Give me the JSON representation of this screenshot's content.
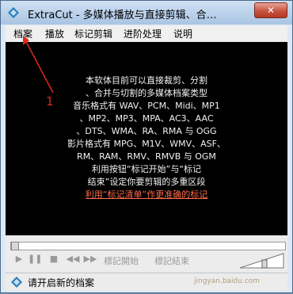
{
  "window": {
    "title": "ExtraCut - 多媒体播放与直接剪辑、合…"
  },
  "menu": [
    {
      "label": "档案"
    },
    {
      "label": "播放"
    },
    {
      "label": "标记剪辑"
    },
    {
      "label": "进阶处理"
    },
    {
      "label": "说明"
    }
  ],
  "content": {
    "lines": [
      "本软体目前可以直接裁剪、分割",
      "、合并与切割的多媒体档案类型",
      "音乐格式有 WAV、PCM、Midi、MP1",
      "、MP2、MP3、MPA、AC3、AAC",
      "、DTS、WMA、RA、RMA 与 OGG",
      "影片格式有 MPG、M1V、WMV、ASF、",
      "RM、RAM、RMV、RMVB 与 OGM",
      "利用按钮“标记开始”与“标记",
      "结束”设定你要剪辑的多重区段",
      "利用“标记清单”作更准确的标记"
    ]
  },
  "annotation": {
    "number": "1"
  },
  "controls": {
    "mark_start_label": "標記開始",
    "mark_end_label": "標記結束",
    "progress": 0
  },
  "status": {
    "text": "请开启新的档案"
  },
  "watermark": {
    "text": "jingyan.baidu.com"
  },
  "colors": {
    "annotation": "#e0291b",
    "highlight_line": "#ff6a4a"
  }
}
